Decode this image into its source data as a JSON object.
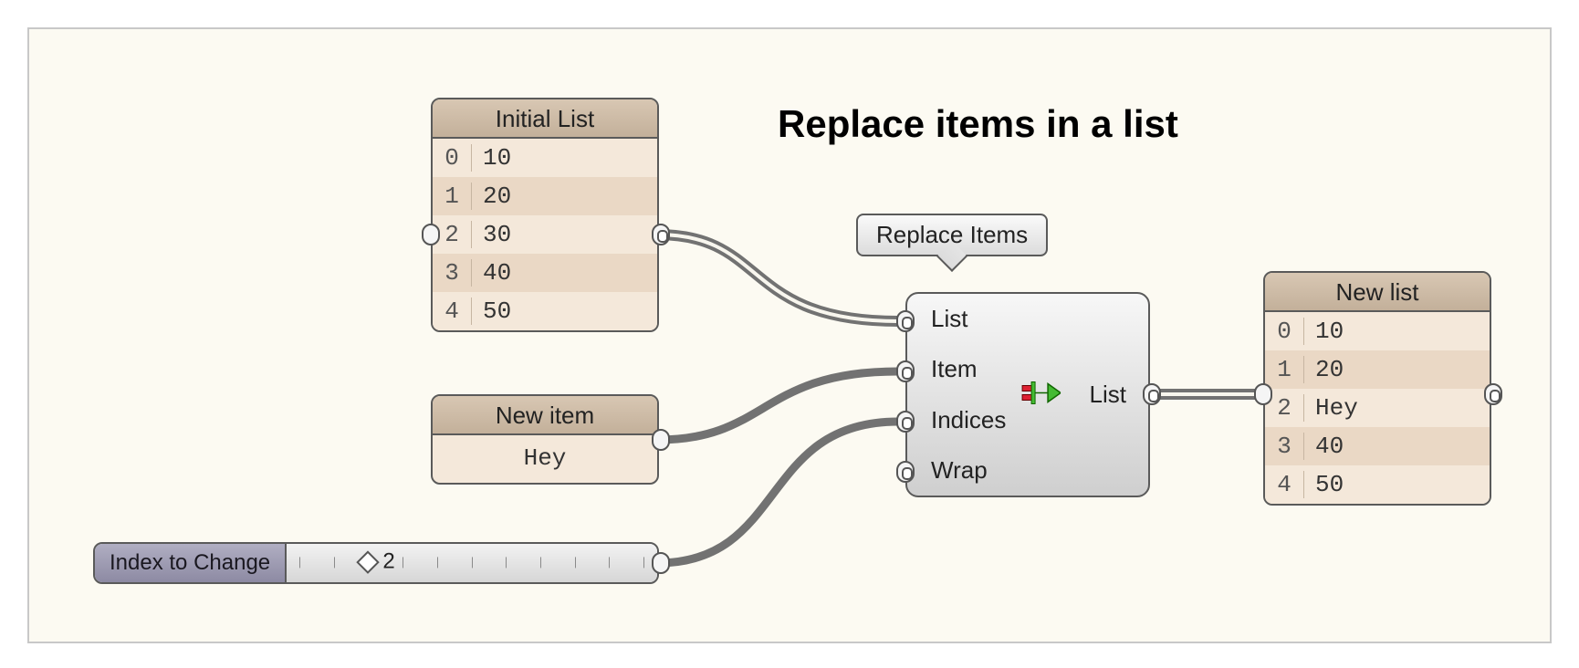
{
  "title": "Replace items in a list",
  "initial_list": {
    "title": "Initial List",
    "rows": [
      {
        "i": "0",
        "v": "10"
      },
      {
        "i": "1",
        "v": "20"
      },
      {
        "i": "2",
        "v": "30"
      },
      {
        "i": "3",
        "v": "40"
      },
      {
        "i": "4",
        "v": "50"
      }
    ]
  },
  "new_item": {
    "title": "New item",
    "value": "Hey"
  },
  "slider": {
    "label": "Index to Change",
    "value": "2",
    "thumb_pct": 22
  },
  "component": {
    "balloon": "Replace Items",
    "inputs": [
      "List",
      "Item",
      "Indices",
      "Wrap"
    ],
    "outputs": [
      "List"
    ]
  },
  "new_list": {
    "title": "New list",
    "rows": [
      {
        "i": "0",
        "v": "10"
      },
      {
        "i": "1",
        "v": "20"
      },
      {
        "i": "2",
        "v": "Hey"
      },
      {
        "i": "3",
        "v": "40"
      },
      {
        "i": "4",
        "v": "50"
      }
    ]
  }
}
